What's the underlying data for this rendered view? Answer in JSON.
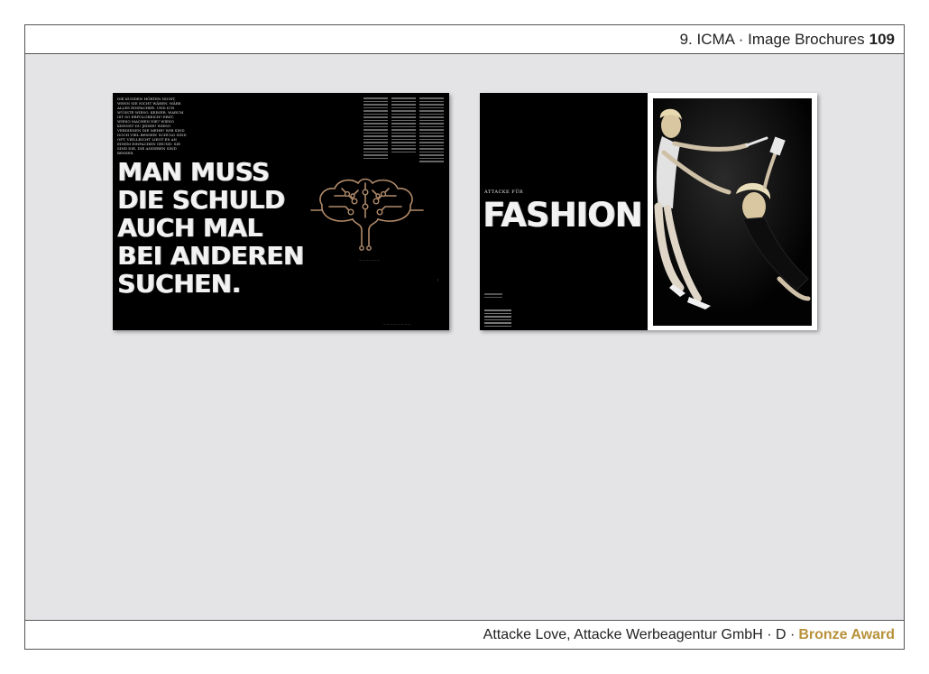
{
  "header": {
    "section": "9. ICMA · Image Brochures",
    "page_number": "109"
  },
  "spread_left": {
    "intro_text": "Die Kunden hörten nicht, wenn sie nicht wären. Wäre alles einfacher. Und ich wüsste wieso. Keiner. Warum ist so erfolgreich? Erst, wieso machen die? Wieso kennst du jeder? Wieso verdienen die mehr? Wir sind doch viel besser! Schuld sind oft. Vielleicht liegt es an einem einfachen Grund: Sie sind die, die anderen sind besser.",
    "headline": "MAN MUSS\nDIE SCHULD\nAUCH MAL\nBEI ANDEREN\nSUCHEN."
  },
  "spread_right": {
    "kicker": "ATTACKE FÜR",
    "headline": "FASHION"
  },
  "footer": {
    "credit": "Attacke Love, Attacke Werbeagentur GmbH · D ·",
    "award": "Bronze Award"
  },
  "colors": {
    "award": "#b8913a",
    "brain": "#b08a6a",
    "background": "#e4e4e6"
  }
}
